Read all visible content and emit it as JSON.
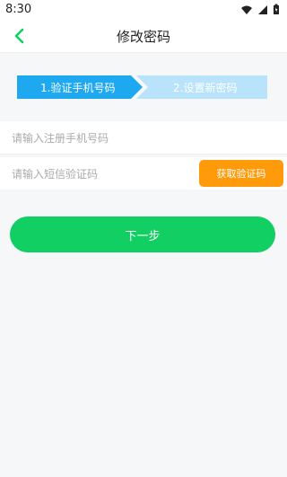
{
  "status": {
    "time": "8:30"
  },
  "header": {
    "title": "修改密码"
  },
  "steps": [
    "1.验证手机号码",
    "2.设置新密码"
  ],
  "form": {
    "phone_placeholder": "请输入注册手机号码",
    "code_placeholder": "请输入短信验证码",
    "get_code_label": "获取验证码"
  },
  "actions": {
    "next_label": "下一步"
  },
  "colors": {
    "accent": "#12cf64",
    "step_active": "#1ea8f0",
    "step_inactive": "#b8e3fb",
    "code_button": "#ff9a0a"
  }
}
